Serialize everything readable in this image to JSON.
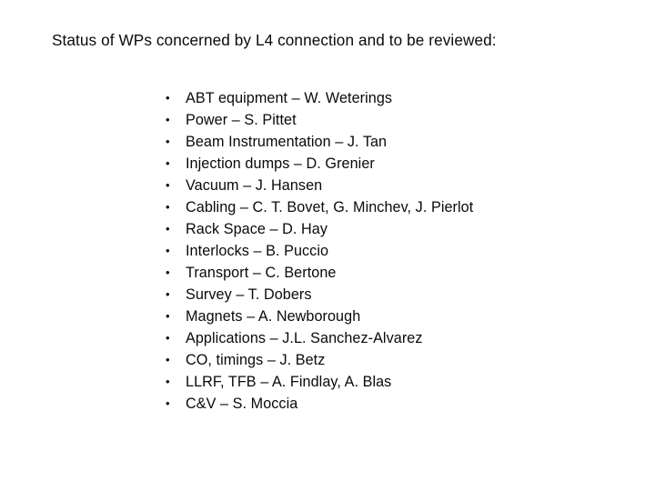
{
  "slide": {
    "title": "Status of WPs concerned by L4 connection and to be reviewed:",
    "background_color": "#ffffff",
    "text_color": "#0a0a0a",
    "bullet_glyph": "•",
    "items": [
      {
        "text": "ABT equipment – W. Weterings"
      },
      {
        "text": "Power – S. Pittet"
      },
      {
        "text": "Beam Instrumentation – J. Tan"
      },
      {
        "text": "Injection dumps – D. Grenier"
      },
      {
        "text": "Vacuum – J. Hansen"
      },
      {
        "text": "Cabling – C. T. Bovet, G. Minchev, J. Pierlot"
      },
      {
        "text": "Rack Space – D. Hay"
      },
      {
        "text": "Interlocks – B. Puccio"
      },
      {
        "text": "Transport – C. Bertone"
      },
      {
        "text": "Survey – T. Dobers"
      },
      {
        "text": "Magnets – A. Newborough"
      },
      {
        "text": "Applications – J.L. Sanchez-Alvarez"
      },
      {
        "text": "CO, timings – J. Betz"
      },
      {
        "text": "LLRF, TFB – A. Findlay, A. Blas"
      },
      {
        "text": "C&V – S. Moccia"
      }
    ]
  }
}
